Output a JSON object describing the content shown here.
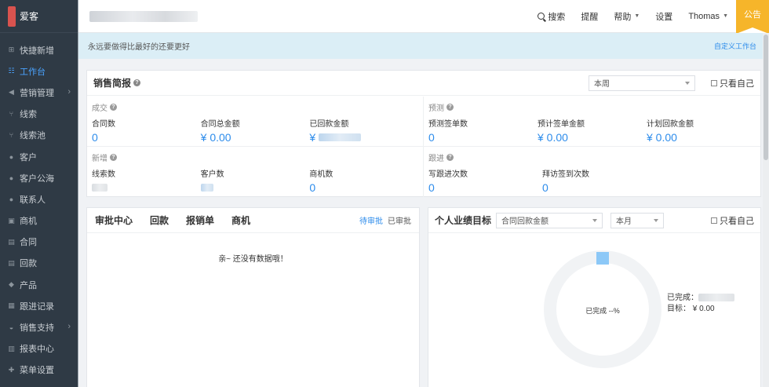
{
  "app": {
    "name": "爱客"
  },
  "sidebar": {
    "items": [
      {
        "label": "快捷新增",
        "icon": "plus-square-icon",
        "glyph": "⊞",
        "active": false,
        "arrow": false
      },
      {
        "label": "工作台",
        "icon": "dashboard-icon",
        "glyph": "☷",
        "active": true,
        "arrow": false
      },
      {
        "label": "营销管理",
        "icon": "megaphone-icon",
        "glyph": "◀",
        "active": false,
        "arrow": true
      },
      {
        "label": "线索",
        "icon": "branch-icon",
        "glyph": "⑂",
        "active": false,
        "arrow": false
      },
      {
        "label": "线索池",
        "icon": "branch-icon",
        "glyph": "⑂",
        "active": false,
        "arrow": false
      },
      {
        "label": "客户",
        "icon": "user-icon",
        "glyph": "●",
        "active": false,
        "arrow": false
      },
      {
        "label": "客户公海",
        "icon": "user-icon",
        "glyph": "●",
        "active": false,
        "arrow": false
      },
      {
        "label": "联系人",
        "icon": "contacts-icon",
        "glyph": "●",
        "active": false,
        "arrow": false
      },
      {
        "label": "商机",
        "icon": "briefcase-icon",
        "glyph": "▣",
        "active": false,
        "arrow": false
      },
      {
        "label": "合同",
        "icon": "document-icon",
        "glyph": "▤",
        "active": false,
        "arrow": false
      },
      {
        "label": "回款",
        "icon": "document-icon",
        "glyph": "▤",
        "active": false,
        "arrow": false
      },
      {
        "label": "产品",
        "icon": "cube-icon",
        "glyph": "◆",
        "active": false,
        "arrow": false
      },
      {
        "label": "跟进记录",
        "icon": "notebook-icon",
        "glyph": "▦",
        "active": false,
        "arrow": false
      },
      {
        "label": "销售支持",
        "icon": "support-icon",
        "glyph": "◒",
        "active": false,
        "arrow": true
      },
      {
        "label": "报表中心",
        "icon": "bar-chart-icon",
        "glyph": "▥",
        "active": false,
        "arrow": false
      },
      {
        "label": "菜单设置",
        "icon": "plus-icon",
        "glyph": "✚",
        "active": false,
        "arrow": false
      }
    ]
  },
  "topbar": {
    "search": "搜索",
    "remind": "提醒",
    "help": "帮助",
    "settings": "设置",
    "user": "Thomas",
    "notice": "公告"
  },
  "banner": {
    "motto": "永远要做得比最好的还要更好",
    "customize": "自定义工作台"
  },
  "sales": {
    "title": "销售简报",
    "period": "本周",
    "only_me": "只看自己",
    "deal": {
      "title": "成交",
      "contracts_label": "合同数",
      "contracts_value": "0",
      "total_label": "合同总金额",
      "total_value": "¥ 0.00",
      "received_label": "已回款金额",
      "received_value": "¥"
    },
    "forecast": {
      "title": "预测",
      "expected_label": "预测签单数",
      "expected_value": "0",
      "amount_label": "预计签单金额",
      "amount_value": "¥ 0.00",
      "plan_label": "计划回款金额",
      "plan_value": "¥ 0.00"
    },
    "added": {
      "title": "新增",
      "leads_label": "线索数",
      "customers_label": "客户数",
      "opps_label": "商机数",
      "opps_value": "0"
    },
    "followup": {
      "title": "跟进",
      "notes_label": "写跟进次数",
      "notes_value": "0",
      "visits_label": "拜访签到次数",
      "visits_value": "0"
    }
  },
  "approval": {
    "tabs": [
      "审批中心",
      "回款",
      "报销单",
      "商机"
    ],
    "pending": "待审批",
    "approved": "已审批",
    "empty": "亲~ 还没有数据哦！"
  },
  "goal": {
    "title": "个人业绩目标",
    "metric": "合同回款金额",
    "period": "本月",
    "only_me": "只看自己",
    "center": "已完成 --%",
    "done_label": "已完成：",
    "target": "目标： ¥ 0.00"
  }
}
